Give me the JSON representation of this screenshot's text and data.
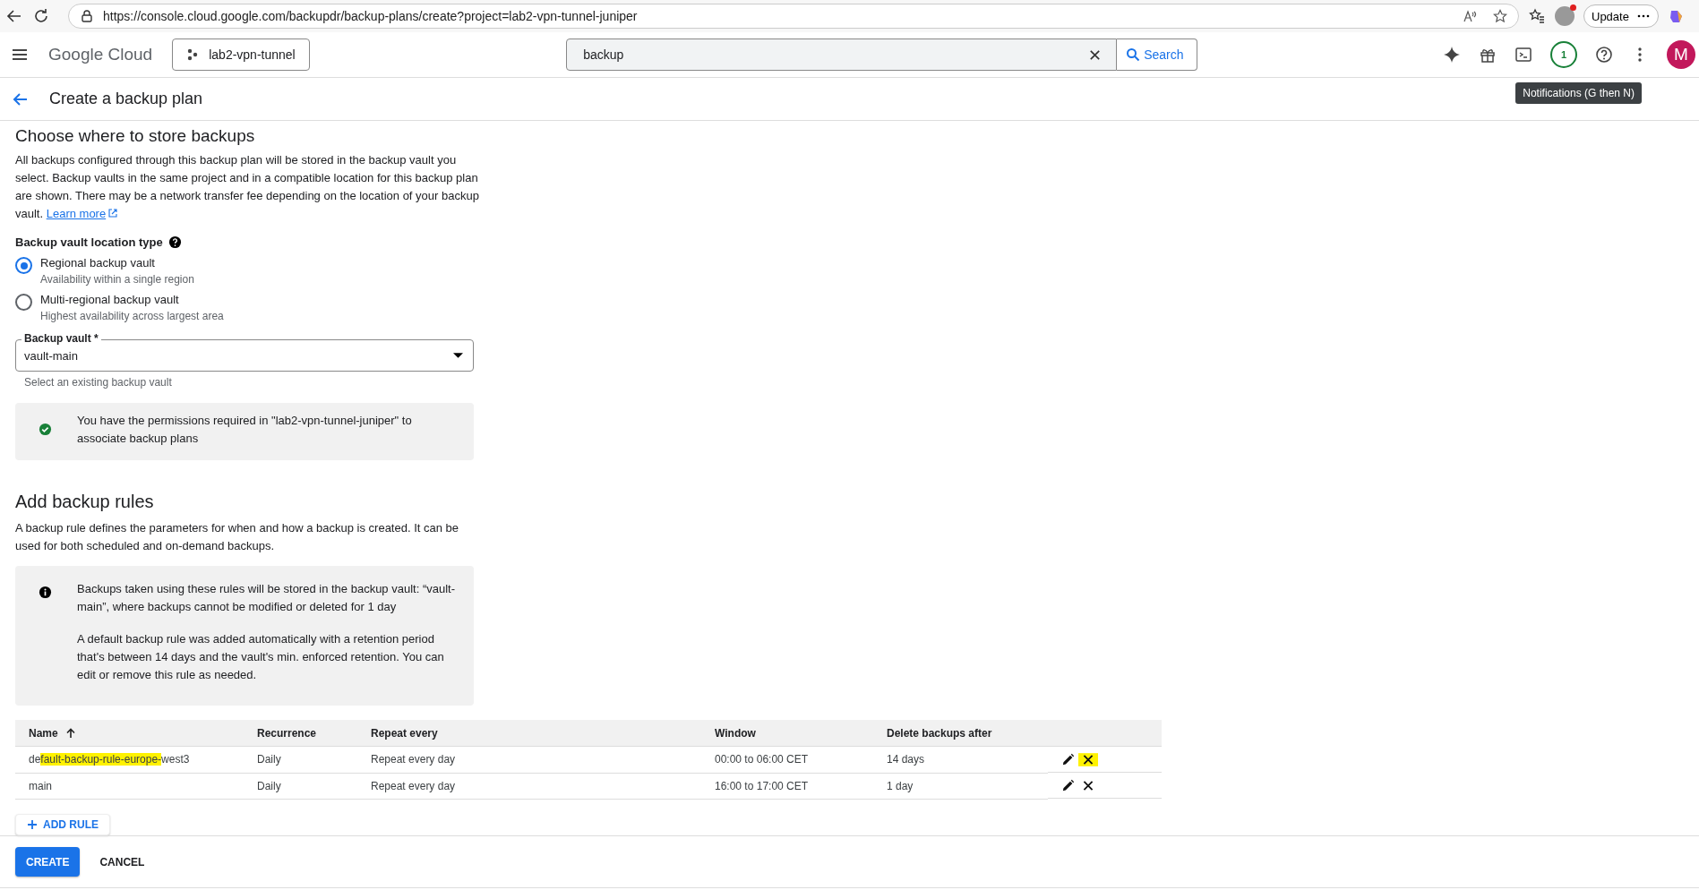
{
  "browser": {
    "url": "https://console.cloud.google.com/backupdr/backup-plans/create?project=lab2-vpn-tunnel-juniper",
    "update_label": "Update"
  },
  "header": {
    "logo": "Google Cloud",
    "project": "lab2-vpn-tunnel",
    "search_value": "backup",
    "search_button": "Search",
    "notification_count": "1",
    "avatar": "M",
    "tooltip": "Notifications (G then N)"
  },
  "page_title": "Create a backup plan",
  "storage": {
    "heading": "Choose where to store backups",
    "description": "All backups configured through this backup plan will be stored in the backup vault you select. Backup vaults in the same project and in a compatible location for this backup plan are shown. There may be a network transfer fee depending on the location of your backup vault.",
    "learn_more": "Learn more",
    "location_label": "Backup vault location type",
    "options": [
      {
        "label": "Regional backup vault",
        "hint": "Availability within a single region",
        "selected": true
      },
      {
        "label": "Multi-regional backup vault",
        "hint": "Highest availability across largest area",
        "selected": false
      }
    ],
    "vault_field": {
      "label": "Backup vault *",
      "value": "vault-main",
      "helper": "Select an existing backup vault"
    },
    "permission_note": "You have the permissions required in \"lab2-vpn-tunnel-juniper\" to associate backup plans"
  },
  "rules": {
    "heading": "Add backup rules",
    "description": "A backup rule defines the parameters for when and how a backup is created. It can be used for both scheduled and on-demand backups.",
    "info": [
      "Backups taken using these rules will be stored in the backup vault: “vault-main”, where backups cannot be modified or deleted for 1 day",
      "A default backup rule was added automatically with a retention period that's between 14 days and the vault's min. enforced retention. You can edit or remove this rule as needed."
    ],
    "table": {
      "columns": [
        "Name",
        "Recurrence",
        "Repeat every",
        "Window",
        "Delete backups after"
      ],
      "rows": [
        {
          "name": [
            {
              "text": "de",
              "highlighted": false
            },
            {
              "text": "fault-backup-rule-europe-",
              "highlighted": true
            },
            {
              "text": "west3",
              "highlighted": false
            }
          ],
          "recurrence": "Daily",
          "repeat": "Repeat every day",
          "window": "00:00 to 06:00 CET",
          "delete_after": "14 days",
          "remove_highlighted": true
        },
        {
          "name": [
            {
              "text": "main",
              "highlighted": false
            }
          ],
          "recurrence": "Daily",
          "repeat": "Repeat every day",
          "window": "16:00 to 17:00 CET",
          "delete_after": "1 day",
          "remove_highlighted": false
        }
      ]
    },
    "add_rule": "ADD RULE"
  },
  "footer": {
    "create": "CREATE",
    "cancel": "CANCEL"
  }
}
